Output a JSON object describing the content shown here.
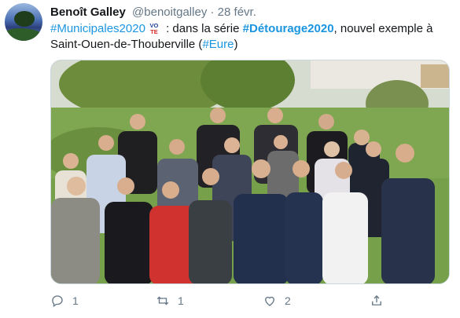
{
  "tweet": {
    "author_name": "Benoît Galley",
    "author_handle": "@benoitgalley",
    "separator": "·",
    "date": "28 févr.",
    "text": {
      "hashtag1": "#Municipales2020",
      "vote_top": "VO",
      "vote_bottom": "TE",
      "part1": " : dans la série ",
      "hashtag2": "#Détourage2020",
      "part2": ", nouvel exemple à Saint-Ouen-de-Thouberville (",
      "hashtag3": "#Eure",
      "part3": ")"
    },
    "avatar_icon": "landscape-avatar",
    "image_description_icon": "group-photo-icon"
  },
  "actions": {
    "reply_count": "1",
    "retweet_count": "1",
    "like_count": "2",
    "reply_icon": "reply-icon",
    "retweet_icon": "retweet-icon",
    "like_icon": "heart-icon",
    "share_icon": "share-icon"
  },
  "colors": {
    "link": "#1b95e0",
    "muted": "#657786",
    "text": "#14171a",
    "border": "#ccd6dd"
  }
}
